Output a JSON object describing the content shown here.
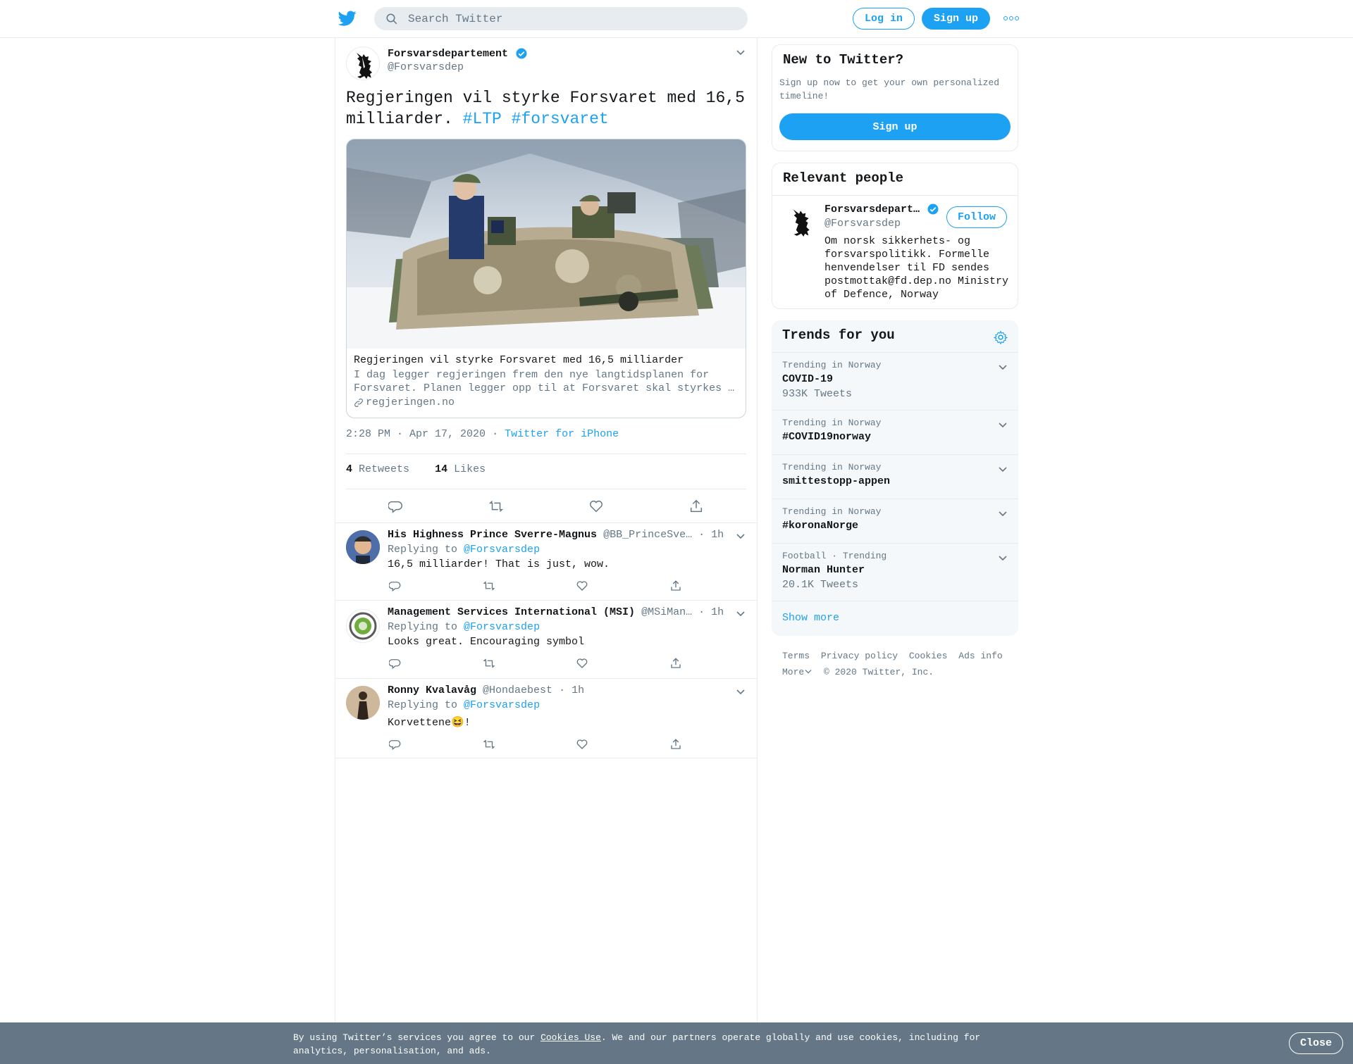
{
  "header": {
    "search_placeholder": "Search Twitter",
    "login_label": "Log in",
    "signup_label": "Sign up"
  },
  "tweet": {
    "author_name": "Forsvarsdepartement",
    "author_handle": "@Forsvarsdep",
    "text": "Regjeringen vil styrke Forsvaret med 16,5 milliarder.",
    "hashtags": [
      "#LTP",
      "#forsvaret"
    ],
    "card": {
      "title": "Regjeringen vil styrke Forsvaret med 16,5 milliarder",
      "description": "I dag legger regjeringen frem den nye langtidsplanen for Forsvaret. Planen legger opp til at Forsvaret skal styrkes …",
      "domain": "regjeringen.no"
    },
    "time": "2:28 PM · Apr 17, 2020",
    "source": "Twitter for iPhone",
    "retweets_count": "4",
    "retweets_label": "Retweets",
    "likes_count": "14",
    "likes_label": "Likes"
  },
  "replies": [
    {
      "name": "His Highness Prince Sverre-Magnus",
      "handle": "@BB_PrinceSve…",
      "time": "· 1h",
      "replying_label": "Replying to",
      "replying_to": "@Forsvarsdep",
      "text": "16,5 milliarder! That is just, wow."
    },
    {
      "name": "Management Services International (MSI)",
      "handle": "@MSiMan…",
      "time": "· 1h",
      "replying_label": "Replying to",
      "replying_to": "@Forsvarsdep",
      "text": "Looks great. Encouraging symbol"
    },
    {
      "name": "Ronny Kvalavåg",
      "handle": "@Hondaebest",
      "time": "· 1h",
      "replying_label": "Replying to",
      "replying_to": "@Forsvarsdep",
      "text": "Korvettene😆!"
    }
  ],
  "new_to_twitter": {
    "title": "New to Twitter?",
    "text": "Sign up now to get your own personalized timeline!",
    "button": "Sign up"
  },
  "relevant_people": {
    "title": "Relevant people",
    "name": "Forsvarsdepart…",
    "handle": "@Forsvarsdep",
    "follow_label": "Follow",
    "bio": "Om norsk sikkerhets- og forsvarspolitikk. Formelle henvendelser til FD sendes postmottak@fd.dep.no Ministry of Defence, Norway"
  },
  "trends": {
    "title": "Trends for you",
    "items": [
      {
        "context": "Trending in Norway",
        "name": "COVID-19",
        "count": "933K Tweets"
      },
      {
        "context": "Trending in Norway",
        "name": "#COVID19norway",
        "count": ""
      },
      {
        "context": "Trending in Norway",
        "name": "smittestopp-appen",
        "count": ""
      },
      {
        "context": "Trending in Norway",
        "name": "#koronaNorge",
        "count": ""
      },
      {
        "context": "Football · Trending",
        "name": "Norman Hunter",
        "count": "20.1K Tweets"
      }
    ],
    "show_more": "Show more"
  },
  "footer": {
    "links": [
      "Terms",
      "Privacy policy",
      "Cookies",
      "Ads info"
    ],
    "more": "More",
    "copyright": "© 2020 Twitter, Inc."
  },
  "cookie_bar": {
    "text_before": "By using Twitter’s services you agree to our ",
    "link": "Cookies Use",
    "text_after": ". We and our partners operate globally and use cookies, including for analytics, personalisation, and ads.",
    "close": "Close"
  },
  "colors": {
    "accent": "#1da1f2",
    "muted": "#657786",
    "border": "#e6ecf0",
    "cookie_bg": "#657786"
  }
}
